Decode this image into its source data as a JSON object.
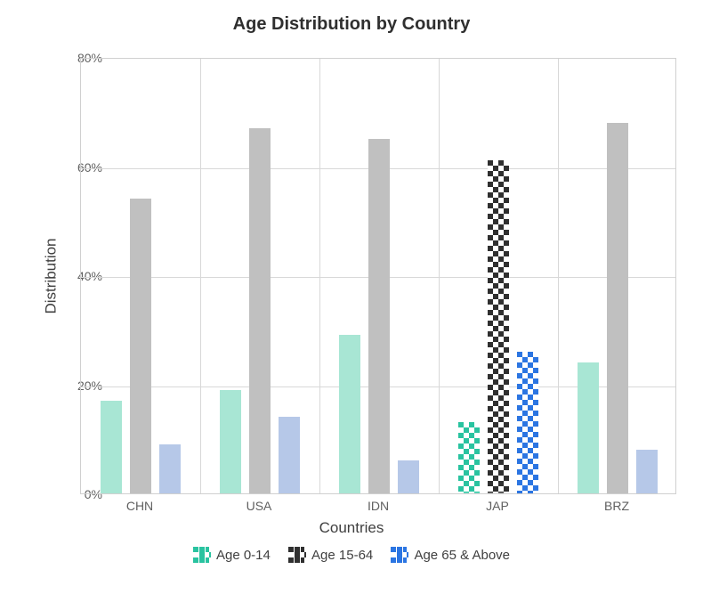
{
  "chart_data": {
    "type": "bar",
    "title": "Age Distribution by Country",
    "xlabel": "Countries",
    "ylabel": "Distribution",
    "categories": [
      "CHN",
      "USA",
      "IDN",
      "JAP",
      "BRZ"
    ],
    "series": [
      {
        "name": "Age 0-14",
        "values": [
          17,
          19,
          29,
          13,
          24
        ],
        "color": "#29c3a0",
        "unselected_color": "#a8e6d4"
      },
      {
        "name": "Age 15-64",
        "values": [
          54,
          67,
          65,
          61,
          68
        ],
        "color": "#2f2f2f",
        "unselected_color": "#c0c0c0"
      },
      {
        "name": "Age 65 & Above",
        "values": [
          9,
          14,
          6,
          26,
          8
        ],
        "color": "#2b75e2",
        "unselected_color": "#b6c8e8"
      }
    ],
    "ylim": [
      0,
      80
    ],
    "yticks": [
      0,
      20,
      40,
      60,
      80
    ],
    "ytick_labels": [
      "0%",
      "20%",
      "40%",
      "60%",
      "80%"
    ],
    "selected_category_index": 3,
    "legend_position": "bottom"
  }
}
